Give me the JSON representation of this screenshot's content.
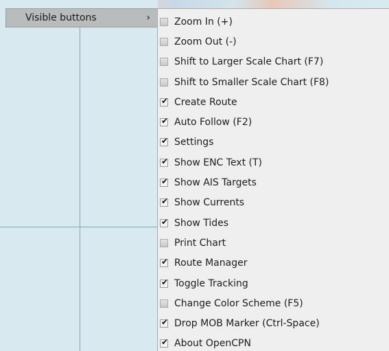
{
  "parent_menu": {
    "label": "Visible buttons",
    "arrow": "›"
  },
  "submenu": {
    "items": [
      {
        "label": "Zoom In (+)",
        "checked": false
      },
      {
        "label": "Zoom Out (-)",
        "checked": false
      },
      {
        "label": "Shift to Larger Scale Chart (F7)",
        "checked": false
      },
      {
        "label": "Shift to Smaller Scale Chart (F8)",
        "checked": false
      },
      {
        "label": "Create Route",
        "checked": true
      },
      {
        "label": "Auto Follow (F2)",
        "checked": true
      },
      {
        "label": "Settings",
        "checked": true
      },
      {
        "label": "Show ENC Text (T)",
        "checked": true
      },
      {
        "label": "Show AIS Targets",
        "checked": true
      },
      {
        "label": "Show Currents",
        "checked": true
      },
      {
        "label": "Show Tides",
        "checked": true
      },
      {
        "label": "Print Chart",
        "checked": false
      },
      {
        "label": "Route Manager",
        "checked": true
      },
      {
        "label": "Toggle Tracking",
        "checked": true
      },
      {
        "label": "Change Color Scheme (F5)",
        "checked": false
      },
      {
        "label": "Drop MOB Marker (Ctrl-Space)",
        "checked": true
      },
      {
        "label": "About OpenCPN",
        "checked": true
      }
    ]
  },
  "colors": {
    "chart_water": "#d8eaf0",
    "menu_bg": "#efefef",
    "parent_highlight": "#b9bcbd"
  }
}
